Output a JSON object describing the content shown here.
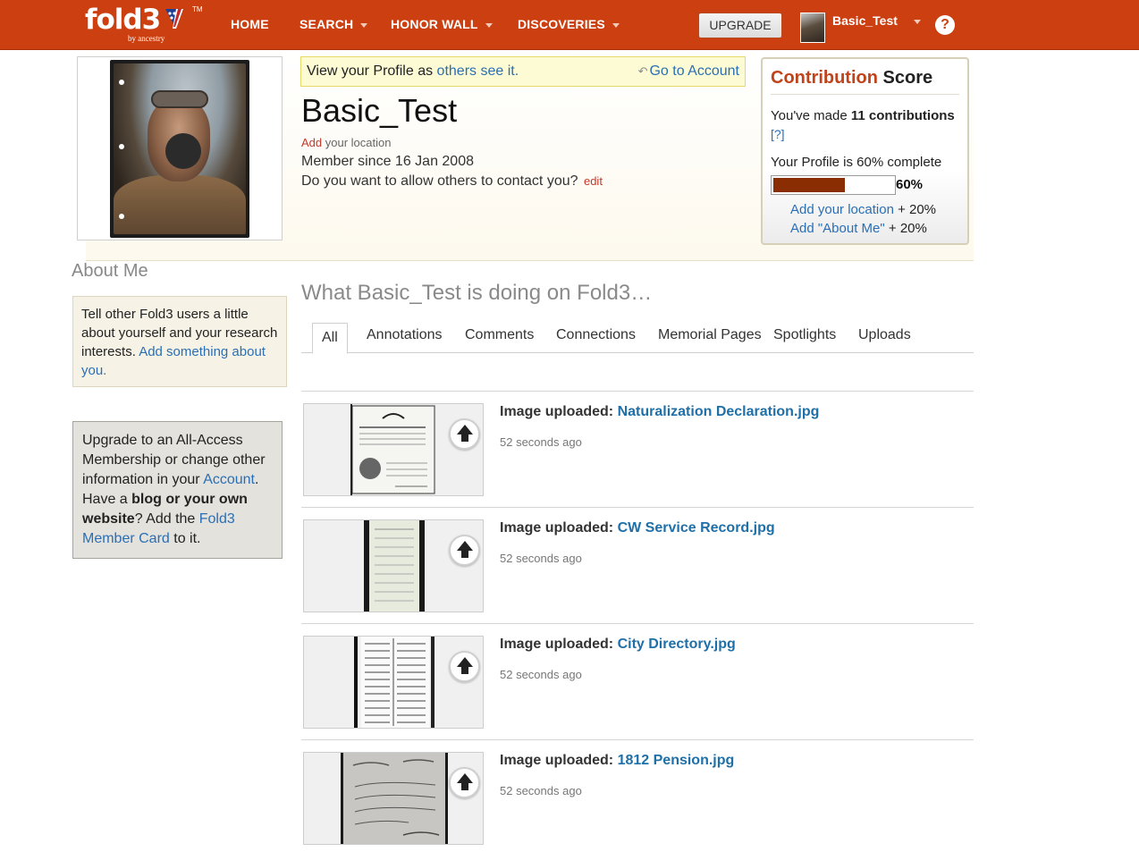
{
  "nav": {
    "logo_text": "fold3",
    "logo_by": "by ancestry",
    "logo_tm": "TM",
    "items": [
      {
        "label": "HOME",
        "has_caret": false
      },
      {
        "label": "SEARCH",
        "has_caret": true
      },
      {
        "label": "HONOR WALL",
        "has_caret": true
      },
      {
        "label": "DISCOVERIES",
        "has_caret": true
      }
    ],
    "upgrade_label": "UPGRADE",
    "user_name": "Basic_Test",
    "help_icon": "?"
  },
  "profile": {
    "view_prefix": "View your Profile as ",
    "view_link": "others see it.",
    "goto_account": "Go to Account",
    "name": "Basic_Test",
    "add_location_link": "Add",
    "add_location_rest": " your location",
    "member_since": "Member since 16 Jan 2008",
    "contact_question": "Do you want to allow others to contact you?",
    "contact_edit": "edit"
  },
  "score": {
    "title_part1": "Contribution",
    "title_part2": " Score",
    "made_prefix": "You've made ",
    "made_count": "11 contributions",
    "help_link": "[?]",
    "complete_text": "Your Profile is 60% complete",
    "progress_percent": 60,
    "progress_label": "60%",
    "suggestions": [
      {
        "link": "Add your location",
        "value": " + 20%"
      },
      {
        "link": "Add \"About Me\"",
        "value": " + 20%"
      }
    ]
  },
  "sidebar": {
    "about_heading": "About Me",
    "about_text": "Tell other Fold3 users a little about yourself and your research interests. ",
    "about_link": "Add something about you.",
    "upgrade_p1": "Upgrade to an All-Access Membership or change other information in your ",
    "upgrade_account_link": "Account",
    "upgrade_p2": ". Have a ",
    "upgrade_bold": "blog or your own website",
    "upgrade_p3": "? Add the ",
    "upgrade_card_link": "Fold3 Member Card",
    "upgrade_p4": " to it."
  },
  "activity": {
    "heading": "What Basic_Test is doing on Fold3…",
    "tabs": [
      "All",
      "Annotations",
      "Comments",
      "Connections",
      "Memorial Pages",
      "Spotlights",
      "Uploads"
    ],
    "active_tab": "All",
    "items": [
      {
        "prefix": "Image uploaded: ",
        "title": "Naturalization Declaration.jpg",
        "time": "52 seconds ago",
        "thumb_icon": "document-thumbnail"
      },
      {
        "prefix": "Image uploaded: ",
        "title": "CW Service Record.jpg",
        "time": "52 seconds ago",
        "thumb_icon": "document-thumbnail"
      },
      {
        "prefix": "Image uploaded: ",
        "title": "City Directory.jpg",
        "time": "52 seconds ago",
        "thumb_icon": "document-thumbnail"
      },
      {
        "prefix": "Image uploaded: ",
        "title": "1812 Pension.jpg",
        "time": "52 seconds ago",
        "thumb_icon": "document-thumbnail"
      }
    ]
  },
  "colors": {
    "nav_bg": "#cc3f10",
    "link": "#2a6fb5",
    "accent_red": "#c0392b",
    "progress_fill": "#8b2d02"
  }
}
